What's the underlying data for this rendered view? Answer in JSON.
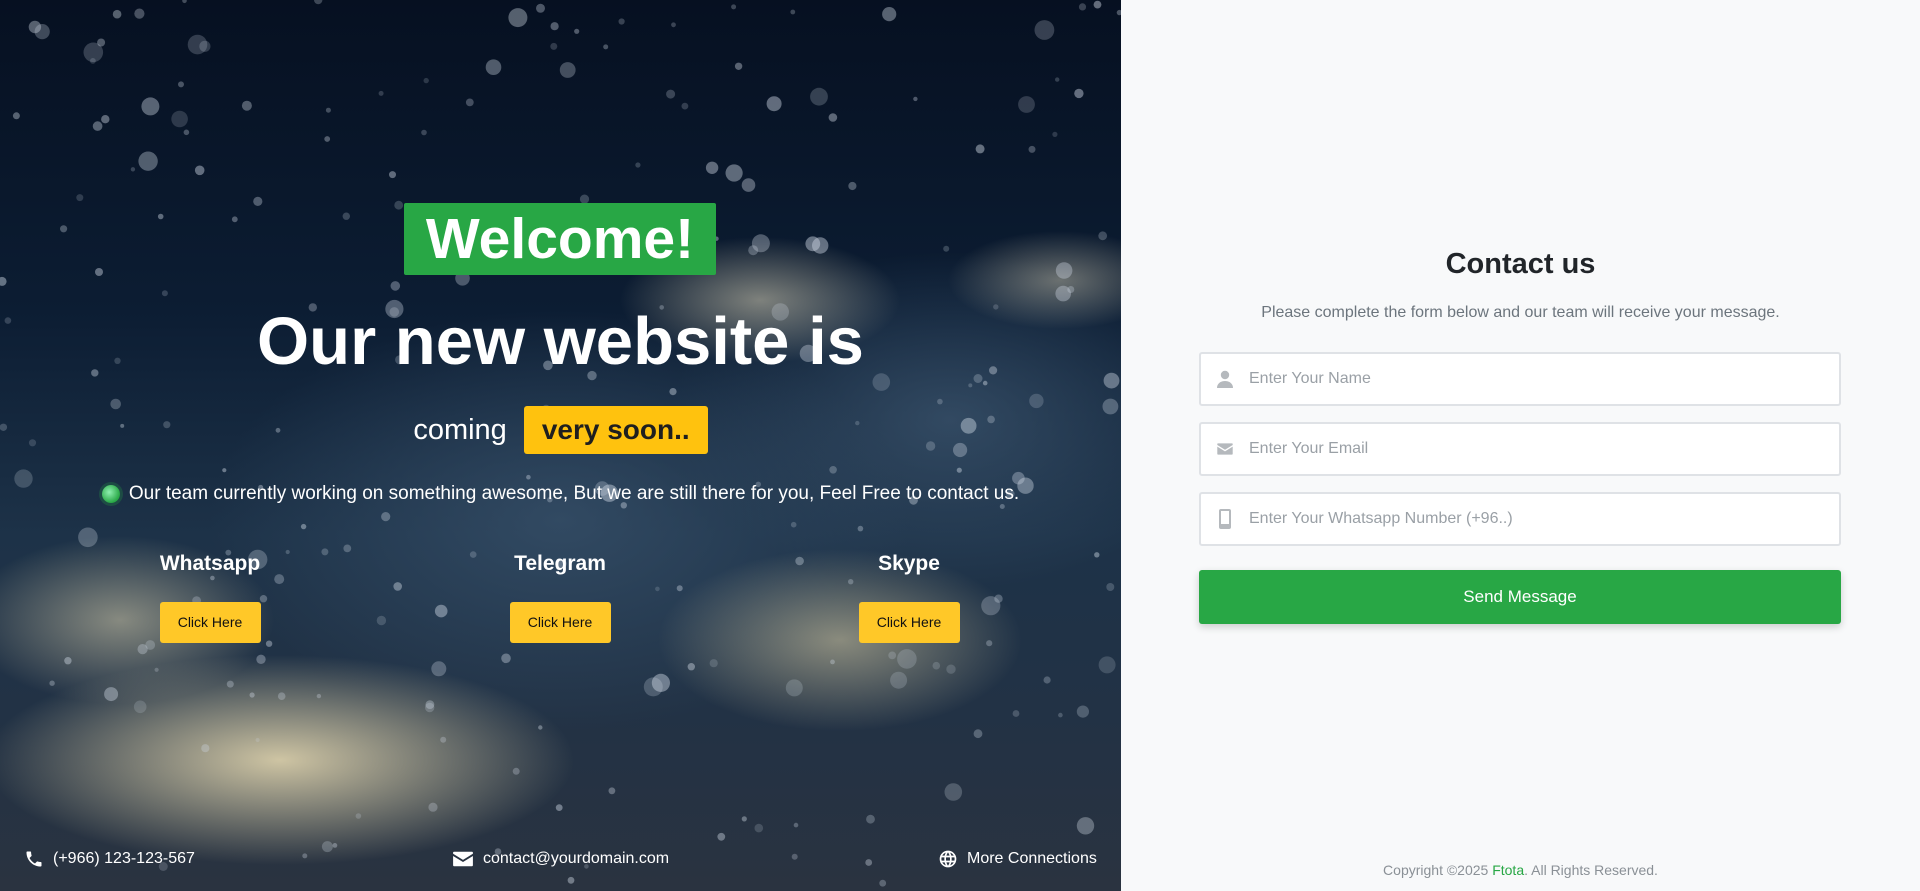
{
  "hero": {
    "welcome": "Welcome!",
    "headline": "Our new website is",
    "coming_word": "coming",
    "soon_badge": "very soon..",
    "team_message": "Our team currently working on something awesome, But we are still there for you, Feel Free to contact us.",
    "channels": [
      {
        "title": "Whatsapp",
        "button": "Click Here"
      },
      {
        "title": "Telegram",
        "button": "Click Here"
      },
      {
        "title": "Skype",
        "button": "Click Here"
      }
    ],
    "footer": {
      "phone": "(+966) 123-123-567",
      "email": "contact@yourdomain.com",
      "more": "More Connections"
    },
    "icons": [
      "phone-icon",
      "envelope-icon",
      "globe-icon"
    ]
  },
  "contact": {
    "title": "Contact us",
    "subtitle": "Please complete the form below and our team will receive your message.",
    "fields": [
      {
        "icon": "user-icon",
        "placeholder": "Enter Your Name",
        "value": ""
      },
      {
        "icon": "envelope-icon",
        "placeholder": "Enter Your Email",
        "value": ""
      },
      {
        "icon": "mobile-icon",
        "placeholder": "Enter Your Whatsapp Number (+96..)",
        "value": ""
      }
    ],
    "submit": "Send Message",
    "copyright_prefix": "Copyright ©2025 ",
    "copyright_brand": "Ftota",
    "copyright_suffix": ". All Rights Reserved."
  },
  "colors": {
    "accent_green": "#28a745",
    "accent_yellow": "#ffc20e",
    "contact_bg": "#f8f9fa"
  }
}
